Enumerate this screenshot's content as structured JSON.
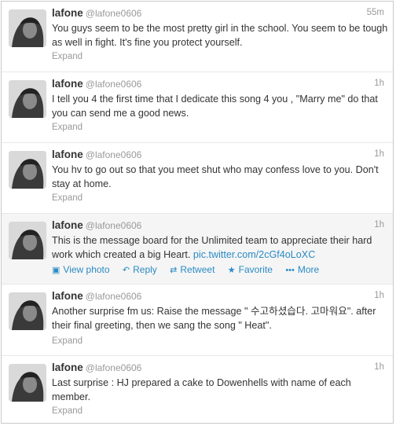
{
  "tweets": [
    {
      "fullname": "lafone",
      "username": "@lafone0606",
      "time": "55m",
      "text": "You guys seem to be the most pretty girl in the school. You seem to be tough as well in fight.  It's fine you protect yourself.",
      "expand": "Expand"
    },
    {
      "fullname": "lafone",
      "username": "@lafone0606",
      "time": "1h",
      "text": "I tell you 4 the first time that I dedicate this song 4 you , \"Marry me\" do that you can send me a good news.",
      "expand": "Expand"
    },
    {
      "fullname": "lafone",
      "username": "@lafone0606",
      "time": "1h",
      "text": "You hv to go out so that you meet shut who may confess love to you. Don't stay at home.",
      "expand": "Expand"
    },
    {
      "fullname": "lafone",
      "username": "@lafone0606",
      "time": "1h",
      "text": "This is the message board for the Unlimited team to appreciate their hard work which created a big Heart.",
      "link": "pic.twitter.com/2cGf4oLoXC",
      "actions": {
        "view_photo": "View photo",
        "reply": "Reply",
        "retweet": "Retweet",
        "favorite": "Favorite",
        "more": "More"
      }
    },
    {
      "fullname": "lafone",
      "username": "@lafone0606",
      "time": "1h",
      "text": "Another surprise fm us: Raise the message \" 수고하셨습다. 고마워요\". after their final greeting, then we sang the song \" Heat\".",
      "expand": "Expand"
    },
    {
      "fullname": "lafone",
      "username": "@lafone0606",
      "time": "1h",
      "text": "Last surprise : HJ prepared a cake  to Dowenhells with name of each member.",
      "expand": "Expand"
    }
  ],
  "icons": {
    "view_photo": "photo-icon",
    "reply": "reply-icon",
    "retweet": "retweet-icon",
    "favorite": "star-icon",
    "more": "more-icon"
  },
  "colors": {
    "link": "#2a8bc4",
    "meta": "#999999",
    "hover_bg": "#f5f5f5"
  }
}
